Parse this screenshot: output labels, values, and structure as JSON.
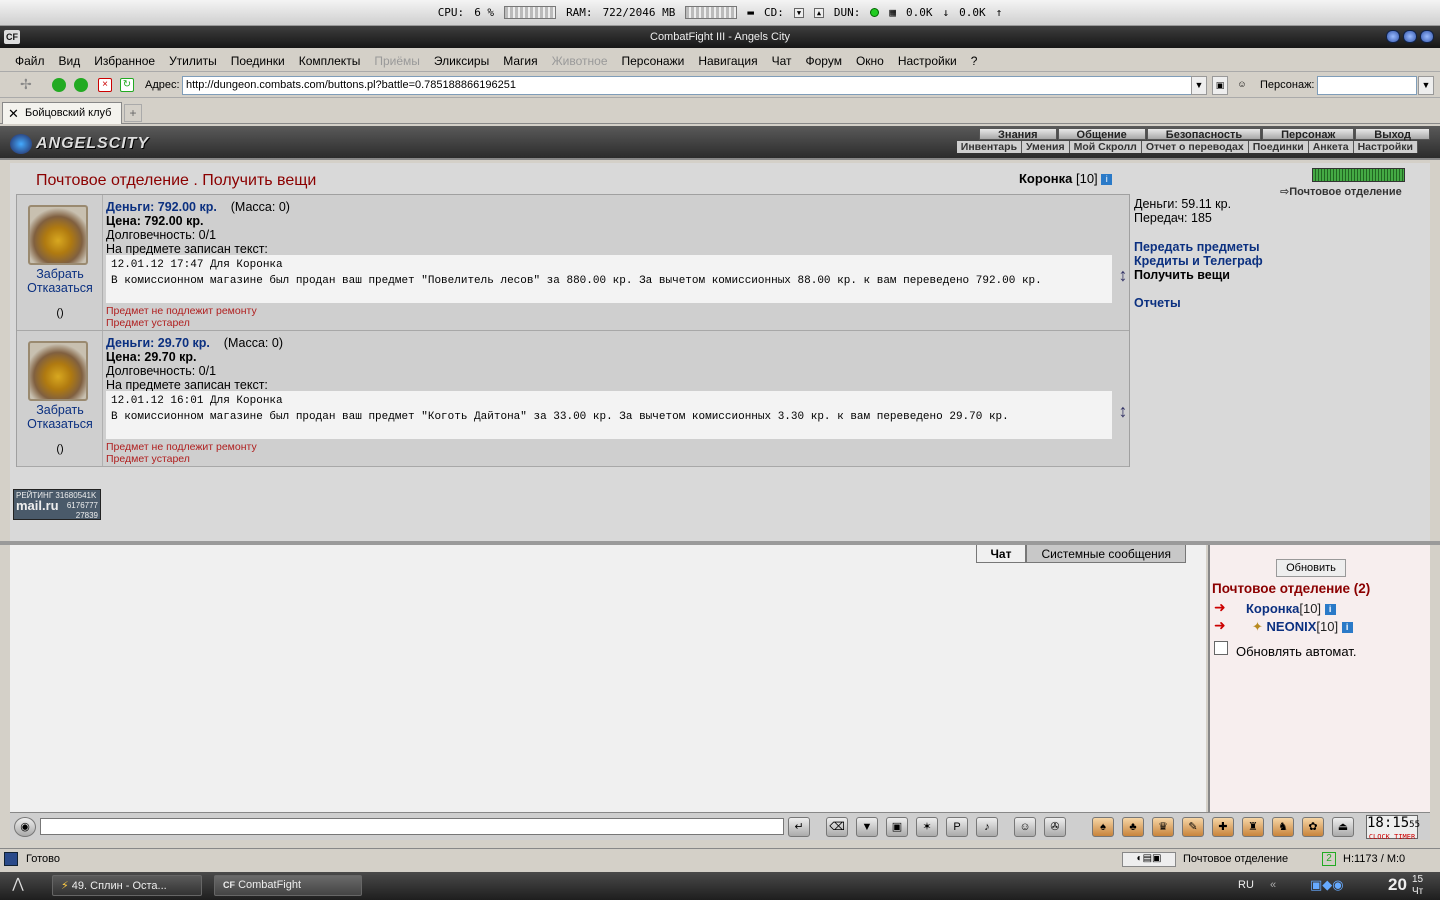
{
  "sysbar": {
    "cpu_label": "CPU:",
    "cpu_value": "6 %",
    "ram_label": "RAM:",
    "ram_value": "722/2046 MB",
    "cd_label": "CD:",
    "dun_label": "DUN:",
    "down": "0.0K",
    "up": "0.0K"
  },
  "window": {
    "title": "CombatFight III - Angels City",
    "logo": "CF"
  },
  "menu": [
    "Файл",
    "Вид",
    "Избранное",
    "Утилиты",
    "Поединки",
    "Комплекты",
    "Приёмы",
    "Эликсиры",
    "Магия",
    "Животное",
    "Персонажи",
    "Навигация",
    "Чат",
    "Форум",
    "Окно",
    "Настройки",
    "?"
  ],
  "address": {
    "label": "Адрес:",
    "url": "http://dungeon.combats.com/buttons.pl?battle=0.785188866196251",
    "persons_label": "Персонаж:"
  },
  "tab": {
    "label": "Бойцовский клуб"
  },
  "game": {
    "logo": "ANGELSCITY",
    "nav_main": [
      "Знания",
      "Общение",
      "Безопасность",
      "Персонаж",
      "Выход"
    ],
    "nav_sub": [
      "Инвентарь",
      "Умения",
      "Мой Скролл",
      "Отчет о переводах",
      "Поединки",
      "Анкета",
      "Настройки"
    ]
  },
  "post": {
    "title": "Почтовое отделение .  Получить вещи",
    "character": "Коронка",
    "character_level": "[10]",
    "location_link": "Почтовое отделение",
    "money": "Деньги: 59.11 кр.",
    "transfers": "Передач: 185",
    "links": {
      "send": "Передать предметы",
      "credits": "Кредиты и Телеграф",
      "receive": "Получить вещи",
      "reports": "Отчеты"
    },
    "items": [
      {
        "money": "Деньги: 792.00 кр.",
        "mass": "(Масса: 0)",
        "price": "Цена: 792.00 кр.",
        "durability": "Долговечность: 0/1",
        "text_label": "На предмете записан текст:",
        "note_line1": "12.01.12 17:47 Для Коронка",
        "note_line2": "В комиссионном магазине был продан ваш предмет \"Повелитель лесов\" за 880.00 кр. За вычетом комиссионных 88.00 кр. к вам переведено 792.00 кр.",
        "take": "Забрать",
        "refuse": "Отказаться",
        "paren": "()",
        "warn1": "Предмет не подлежит ремонту",
        "warn2": "Предмет устарел"
      },
      {
        "money": "Деньги: 29.70 кр.",
        "mass": "(Масса: 0)",
        "price": "Цена: 29.70 кр.",
        "durability": "Долговечность: 0/1",
        "text_label": "На предмете записан текст:",
        "note_line1": "12.01.12 16:01 Для Коронка",
        "note_line2": "В комиссионном магазине был продан ваш предмет \"Коготь Дайтона\" за 33.00 кр. За вычетом комиссионных 3.30 кр. к вам переведено 29.70 кр.",
        "take": "Забрать",
        "refuse": "Отказаться",
        "paren": "()",
        "warn1": "Предмет не подлежит ремонту",
        "warn2": "Предмет устарел"
      }
    ],
    "rating": {
      "label": "РЕЙТИНГ",
      "n1": "31680541K",
      "brand": "mail.ru",
      "n2": "6176777",
      "n3": "27839"
    }
  },
  "chat": {
    "tab_chat": "Чат",
    "tab_system": "Системные сообщения"
  },
  "online": {
    "refresh": "Обновить",
    "title": "Почтовое отделение (2)",
    "users": [
      {
        "name": "Коронка",
        "level": "[10]"
      },
      {
        "name": "NEONIX",
        "level": "[10]"
      }
    ],
    "auto": "Обновлять автомат."
  },
  "clock": {
    "time": "18:15",
    "sec": "55",
    "a": "CLOCK",
    "b": "TIMER"
  },
  "status": {
    "ready": "Готово",
    "location": "Почтовое отделение",
    "counter": "H:1173 / M:0"
  },
  "taskbar": {
    "task1": "49. Сплин - Оста...",
    "task2": "CombatFight",
    "lang": "RU",
    "time": "20",
    "time_min": "15",
    "day": "Чт"
  }
}
